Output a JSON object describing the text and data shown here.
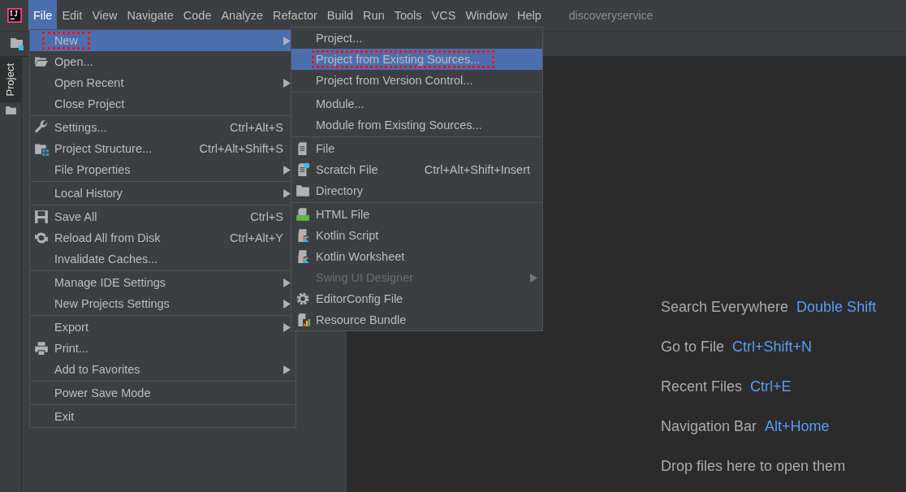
{
  "menu_bar": {
    "items": [
      {
        "label": "File",
        "selected": true
      },
      {
        "label": "Edit",
        "selected": false
      },
      {
        "label": "View",
        "selected": false
      },
      {
        "label": "Navigate",
        "selected": false
      },
      {
        "label": "Code",
        "selected": false
      },
      {
        "label": "Analyze",
        "selected": false
      },
      {
        "label": "Refactor",
        "selected": false
      },
      {
        "label": "Build",
        "selected": false
      },
      {
        "label": "Run",
        "selected": false
      },
      {
        "label": "Tools",
        "selected": false
      },
      {
        "label": "VCS",
        "selected": false
      },
      {
        "label": "Window",
        "selected": false
      },
      {
        "label": "Help",
        "selected": false
      }
    ],
    "project_name": "discoveryservice"
  },
  "tool_window_tab": {
    "label": "Project"
  },
  "file_menu": [
    {
      "kind": "item",
      "label": "New",
      "selected": true,
      "has_submenu": true,
      "annotated": true
    },
    {
      "kind": "item",
      "label": "Open...",
      "selected": false,
      "has_submenu": false,
      "annotated": false
    },
    {
      "kind": "item",
      "label": "Open Recent",
      "selected": false,
      "has_submenu": true,
      "annotated": false
    },
    {
      "kind": "item",
      "label": "Close Project",
      "selected": false,
      "has_submenu": false,
      "annotated": false
    },
    {
      "kind": "separator"
    },
    {
      "kind": "item",
      "label": "Settings...",
      "shortcut": "Ctrl+Alt+S",
      "selected": false,
      "has_submenu": false,
      "annotated": false
    },
    {
      "kind": "item",
      "label": "Project Structure...",
      "shortcut": "Ctrl+Alt+Shift+S",
      "selected": false,
      "has_submenu": false,
      "annotated": false
    },
    {
      "kind": "item",
      "label": "File Properties",
      "selected": false,
      "has_submenu": true,
      "annotated": false
    },
    {
      "kind": "separator"
    },
    {
      "kind": "item",
      "label": "Local History",
      "selected": false,
      "has_submenu": true,
      "annotated": false
    },
    {
      "kind": "separator"
    },
    {
      "kind": "item",
      "label": "Save All",
      "shortcut": "Ctrl+S",
      "selected": false,
      "has_submenu": false,
      "annotated": false
    },
    {
      "kind": "item",
      "label": "Reload All from Disk",
      "shortcut": "Ctrl+Alt+Y",
      "selected": false,
      "has_submenu": false,
      "annotated": false
    },
    {
      "kind": "item",
      "label": "Invalidate Caches...",
      "selected": false,
      "has_submenu": false,
      "annotated": false
    },
    {
      "kind": "separator"
    },
    {
      "kind": "item",
      "label": "Manage IDE Settings",
      "selected": false,
      "has_submenu": true,
      "annotated": false
    },
    {
      "kind": "item",
      "label": "New Projects Settings",
      "selected": false,
      "has_submenu": true,
      "annotated": false
    },
    {
      "kind": "separator"
    },
    {
      "kind": "item",
      "label": "Export",
      "selected": false,
      "has_submenu": true,
      "annotated": false
    },
    {
      "kind": "item",
      "label": "Print...",
      "selected": false,
      "has_submenu": false,
      "annotated": false
    },
    {
      "kind": "item",
      "label": "Add to Favorites",
      "selected": false,
      "has_submenu": true,
      "annotated": false
    },
    {
      "kind": "separator"
    },
    {
      "kind": "item",
      "label": "Power Save Mode",
      "selected": false,
      "has_submenu": false,
      "annotated": false
    },
    {
      "kind": "separator"
    },
    {
      "kind": "item",
      "label": "Exit",
      "selected": false,
      "has_submenu": false,
      "annotated": false
    }
  ],
  "new_submenu": [
    {
      "kind": "item",
      "label": "Project...",
      "selected": false,
      "has_submenu": false,
      "annotated": false,
      "disabled": false
    },
    {
      "kind": "item",
      "label": "Project from Existing Sources...",
      "selected": true,
      "has_submenu": false,
      "annotated": true,
      "disabled": false
    },
    {
      "kind": "item",
      "label": "Project from Version Control...",
      "selected": false,
      "has_submenu": false,
      "annotated": false,
      "disabled": false
    },
    {
      "kind": "separator"
    },
    {
      "kind": "item",
      "label": "Module...",
      "selected": false,
      "has_submenu": false,
      "annotated": false,
      "disabled": false
    },
    {
      "kind": "item",
      "label": "Module from Existing Sources...",
      "selected": false,
      "has_submenu": false,
      "annotated": false,
      "disabled": false
    },
    {
      "kind": "separator"
    },
    {
      "kind": "item",
      "label": "File",
      "selected": false,
      "has_submenu": false,
      "annotated": false,
      "disabled": false
    },
    {
      "kind": "item",
      "label": "Scratch File",
      "shortcut": "Ctrl+Alt+Shift+Insert",
      "selected": false,
      "has_submenu": false,
      "annotated": false,
      "disabled": false
    },
    {
      "kind": "item",
      "label": "Directory",
      "selected": false,
      "has_submenu": false,
      "annotated": false,
      "disabled": false
    },
    {
      "kind": "separator"
    },
    {
      "kind": "item",
      "label": "HTML File",
      "selected": false,
      "has_submenu": false,
      "annotated": false,
      "disabled": false
    },
    {
      "kind": "item",
      "label": "Kotlin Script",
      "selected": false,
      "has_submenu": false,
      "annotated": false,
      "disabled": false
    },
    {
      "kind": "item",
      "label": "Kotlin Worksheet",
      "selected": false,
      "has_submenu": false,
      "annotated": false,
      "disabled": false
    },
    {
      "kind": "item",
      "label": "Swing UI Designer",
      "selected": false,
      "has_submenu": true,
      "annotated": false,
      "disabled": true
    },
    {
      "kind": "item",
      "label": "EditorConfig File",
      "selected": false,
      "has_submenu": false,
      "annotated": false,
      "disabled": false
    },
    {
      "kind": "item",
      "label": "Resource Bundle",
      "selected": false,
      "has_submenu": false,
      "annotated": false,
      "disabled": false
    }
  ],
  "editor_hints": [
    {
      "label": "Search Everywhere",
      "shortcut": "Double Shift"
    },
    {
      "label": "Go to File",
      "shortcut": "Ctrl+Shift+N"
    },
    {
      "label": "Recent Files",
      "shortcut": "Ctrl+E"
    },
    {
      "label": "Navigation Bar",
      "shortcut": "Alt+Home"
    },
    {
      "label": "Drop files here to open them"
    }
  ]
}
